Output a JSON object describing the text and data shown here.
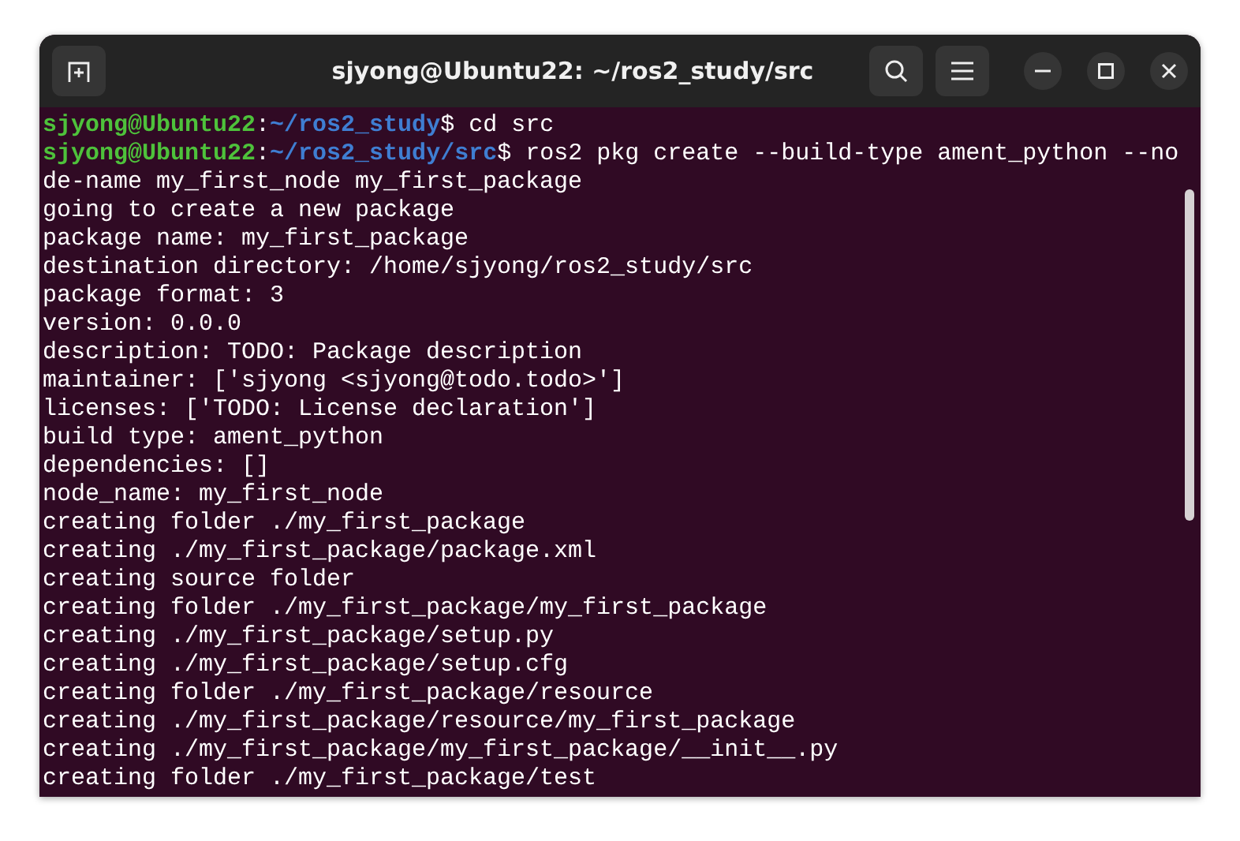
{
  "window": {
    "title": "sjyong@Ubuntu22: ~/ros2_study/src"
  },
  "terminal": {
    "lines": [
      {
        "kind": "prompt",
        "user": "sjyong@Ubuntu22",
        "sep": ":",
        "path": "~/ros2_study",
        "command": "$ cd src"
      },
      {
        "kind": "prompt",
        "user": "sjyong@Ubuntu22",
        "sep": ":",
        "path": "~/ros2_study/src",
        "command": "$ ros2 pkg create --build-type ament_python --no"
      },
      {
        "kind": "output",
        "text": "de-name my_first_node my_first_package"
      },
      {
        "kind": "output",
        "text": "going to create a new package"
      },
      {
        "kind": "output",
        "text": "package name: my_first_package"
      },
      {
        "kind": "output",
        "text": "destination directory: /home/sjyong/ros2_study/src"
      },
      {
        "kind": "output",
        "text": "package format: 3"
      },
      {
        "kind": "output",
        "text": "version: 0.0.0"
      },
      {
        "kind": "output",
        "text": "description: TODO: Package description"
      },
      {
        "kind": "output",
        "text": "maintainer: ['sjyong <sjyong@todo.todo>']"
      },
      {
        "kind": "output",
        "text": "licenses: ['TODO: License declaration']"
      },
      {
        "kind": "output",
        "text": "build type: ament_python"
      },
      {
        "kind": "output",
        "text": "dependencies: []"
      },
      {
        "kind": "output",
        "text": "node_name: my_first_node"
      },
      {
        "kind": "output",
        "text": "creating folder ./my_first_package"
      },
      {
        "kind": "output",
        "text": "creating ./my_first_package/package.xml"
      },
      {
        "kind": "output",
        "text": "creating source folder"
      },
      {
        "kind": "output",
        "text": "creating folder ./my_first_package/my_first_package"
      },
      {
        "kind": "output",
        "text": "creating ./my_first_package/setup.py"
      },
      {
        "kind": "output",
        "text": "creating ./my_first_package/setup.cfg"
      },
      {
        "kind": "output",
        "text": "creating folder ./my_first_package/resource"
      },
      {
        "kind": "output",
        "text": "creating ./my_first_package/resource/my_first_package"
      },
      {
        "kind": "output",
        "text": "creating ./my_first_package/my_first_package/__init__.py"
      },
      {
        "kind": "output",
        "text": "creating folder ./my_first_package/test"
      }
    ]
  }
}
